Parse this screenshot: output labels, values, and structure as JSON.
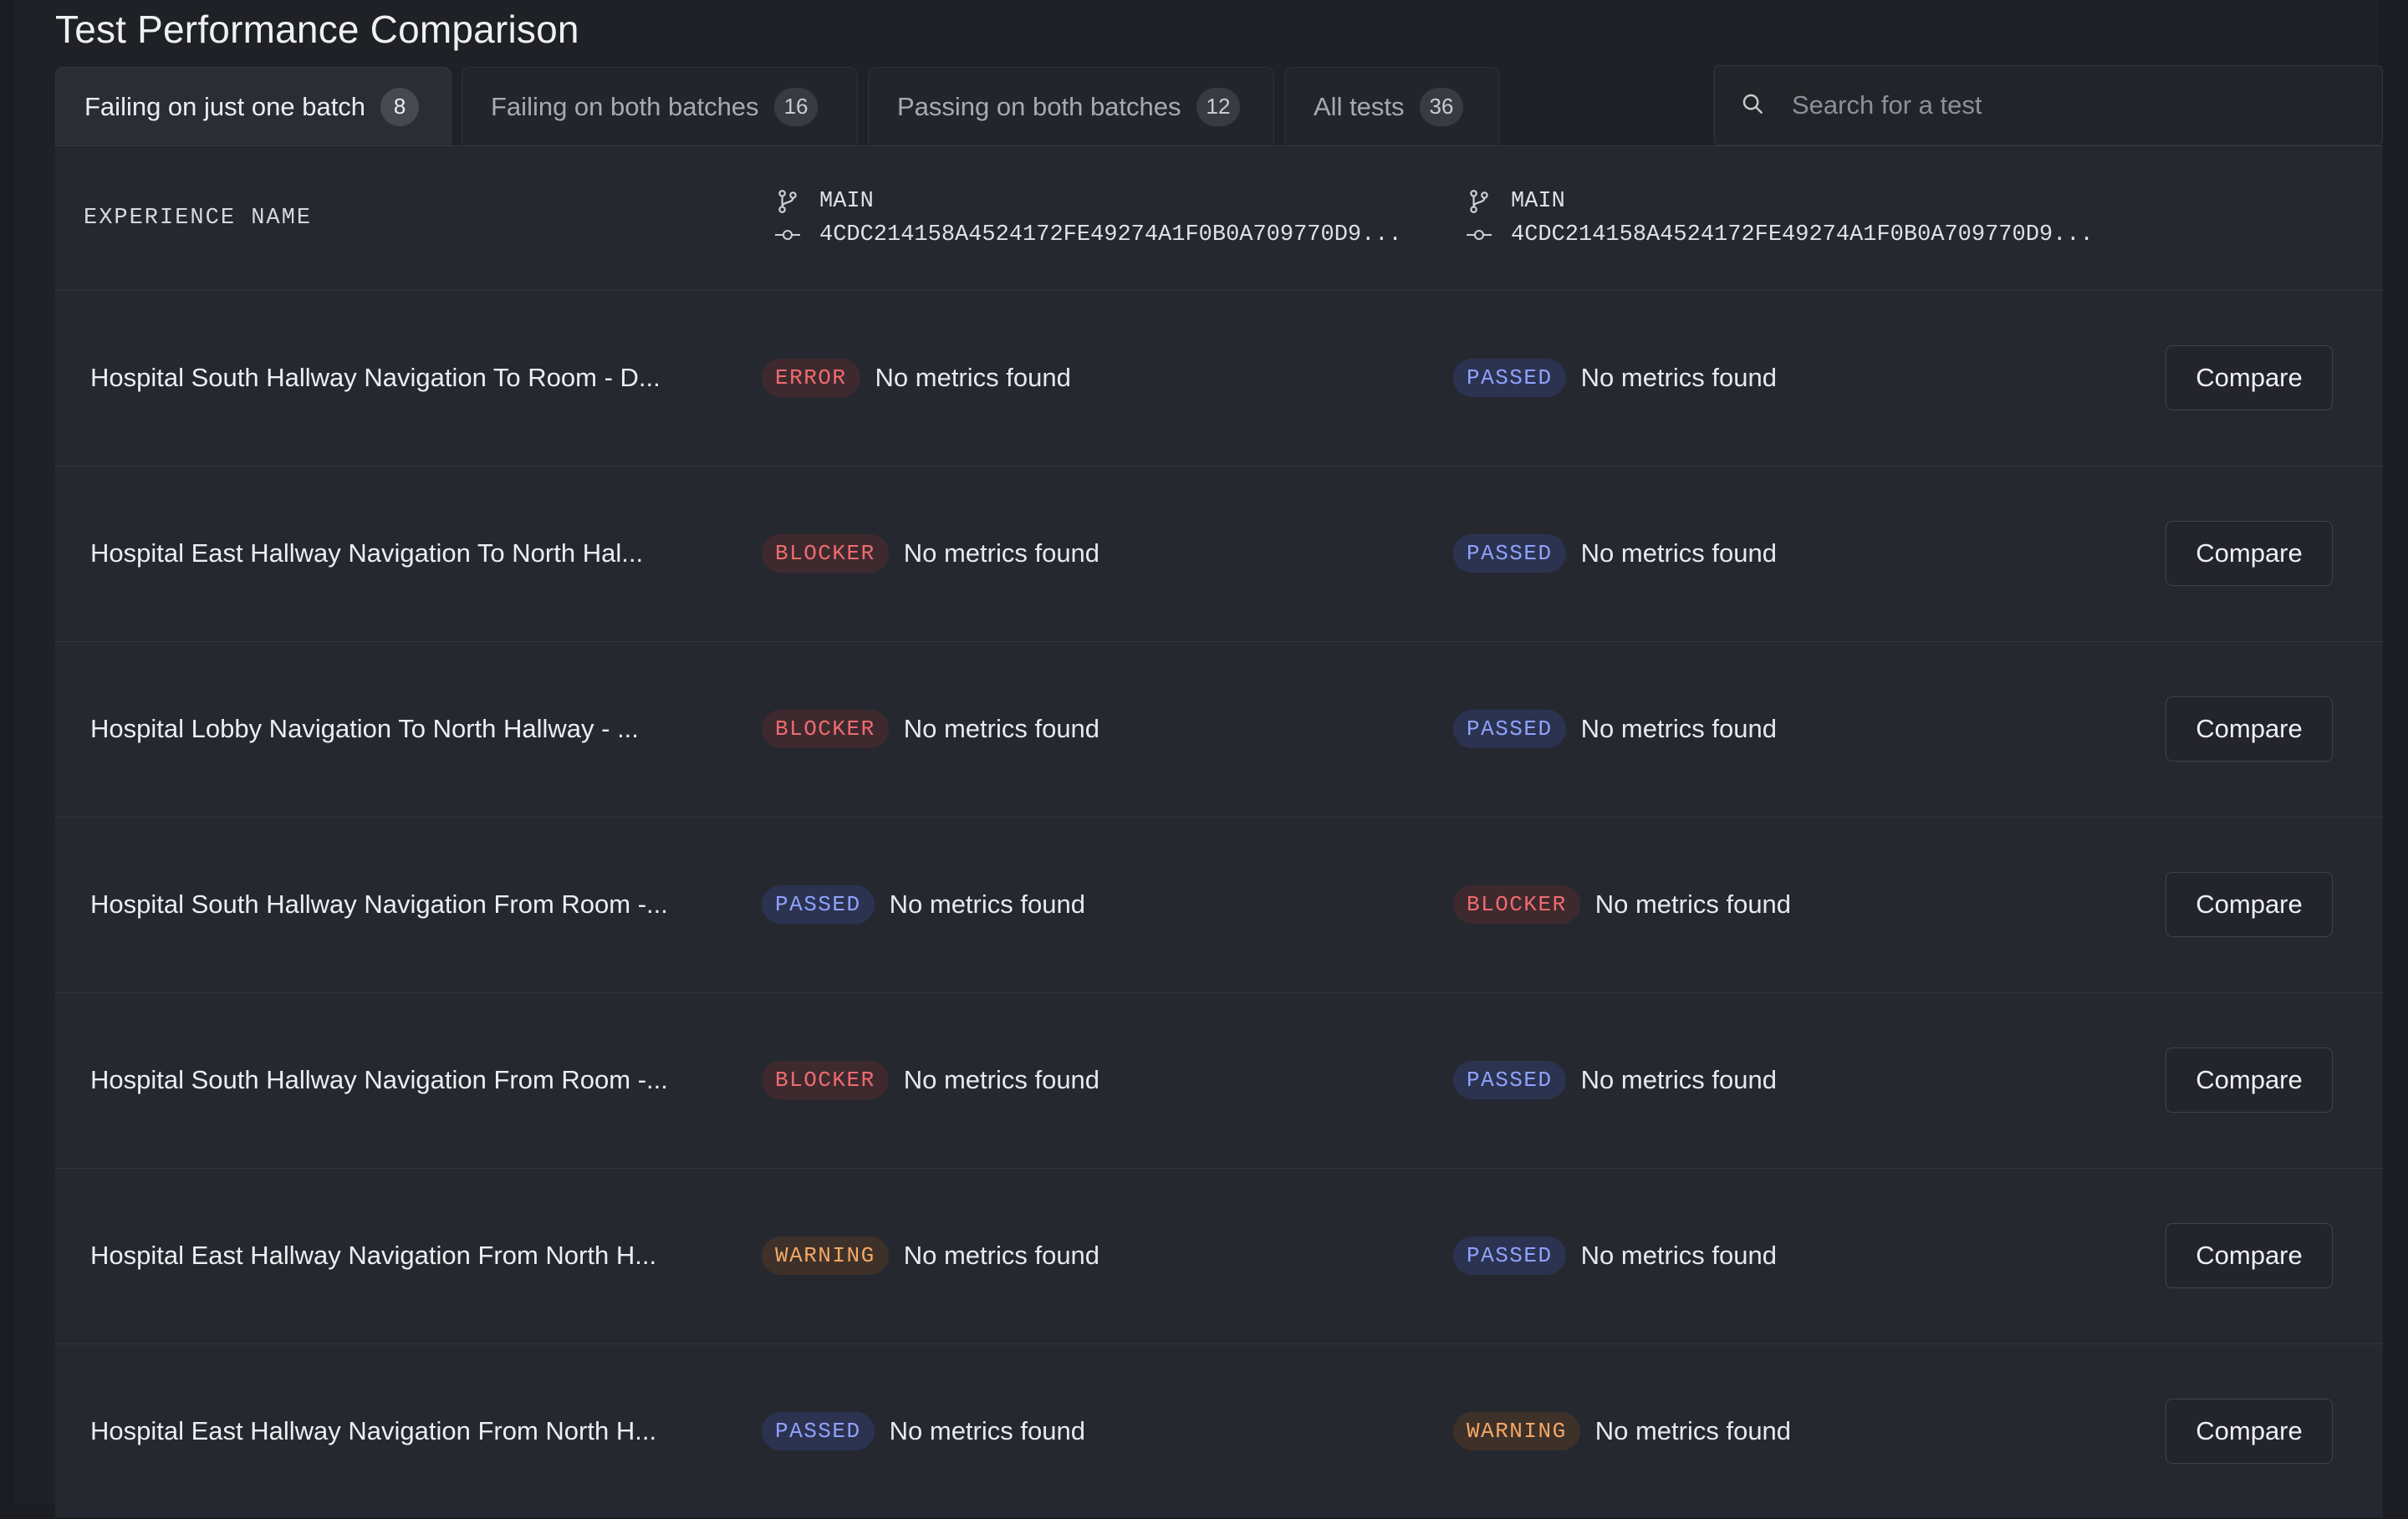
{
  "page": {
    "title": "Test Performance Comparison"
  },
  "tabs": [
    {
      "label": "Failing on just one batch",
      "count": "8",
      "active": true
    },
    {
      "label": "Failing on both batches",
      "count": "16",
      "active": false
    },
    {
      "label": "Passing on both batches",
      "count": "12",
      "active": false
    },
    {
      "label": "All tests",
      "count": "36",
      "active": false
    }
  ],
  "search": {
    "placeholder": "Search for a test"
  },
  "table": {
    "experience_header": "EXPERIENCE NAME",
    "batches": [
      {
        "branch": "MAIN",
        "commit": "4CDC214158A4524172FE49274A1F0B0A709770D9..."
      },
      {
        "branch": "MAIN",
        "commit": "4CDC214158A4524172FE49274A1F0B0A709770D9..."
      }
    ],
    "compare_label": "Compare",
    "rows": [
      {
        "name": "Hospital South Hallway Navigation To Room - D...",
        "a_status": "ERROR",
        "a_metrics": "No metrics found",
        "b_status": "PASSED",
        "b_metrics": "No metrics found"
      },
      {
        "name": "Hospital East Hallway Navigation To North Hal...",
        "a_status": "BLOCKER",
        "a_metrics": "No metrics found",
        "b_status": "PASSED",
        "b_metrics": "No metrics found"
      },
      {
        "name": "Hospital Lobby Navigation To North Hallway - ...",
        "a_status": "BLOCKER",
        "a_metrics": "No metrics found",
        "b_status": "PASSED",
        "b_metrics": "No metrics found"
      },
      {
        "name": "Hospital South Hallway Navigation From Room -...",
        "a_status": "PASSED",
        "a_metrics": "No metrics found",
        "b_status": "BLOCKER",
        "b_metrics": "No metrics found"
      },
      {
        "name": "Hospital South Hallway Navigation From Room -...",
        "a_status": "BLOCKER",
        "a_metrics": "No metrics found",
        "b_status": "PASSED",
        "b_metrics": "No metrics found"
      },
      {
        "name": "Hospital East Hallway Navigation From North H...",
        "a_status": "WARNING",
        "a_metrics": "No metrics found",
        "b_status": "PASSED",
        "b_metrics": "No metrics found"
      },
      {
        "name": "Hospital East Hallway Navigation From North H...",
        "a_status": "PASSED",
        "a_metrics": "No metrics found",
        "b_status": "WARNING",
        "b_metrics": "No metrics found"
      }
    ]
  },
  "colors": {
    "passed": "#8fa2ff",
    "error": "#f06b6f",
    "blocker": "#f06b6f",
    "warning": "#f4a867"
  },
  "icons": {
    "branch": "git-branch-icon",
    "commit": "git-commit-icon",
    "search": "search-icon"
  }
}
